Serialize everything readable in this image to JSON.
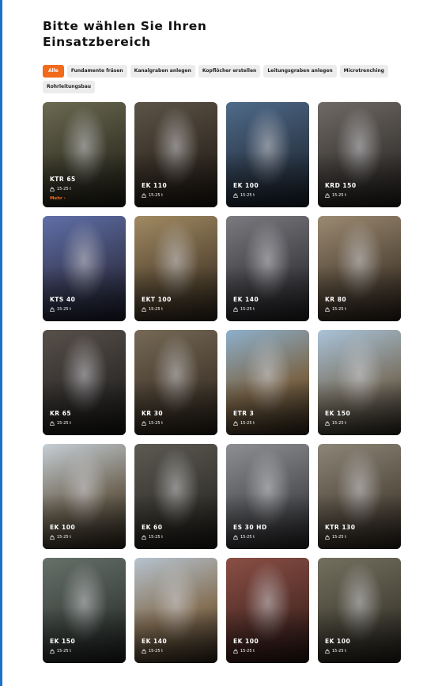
{
  "heading": "Bitte wählen Sie Ihren Einsatzbereich",
  "filters": [
    {
      "label": "Alle",
      "active": true
    },
    {
      "label": "Fundamente fräsen",
      "active": false
    },
    {
      "label": "Kanalgraben anlegen",
      "active": false
    },
    {
      "label": "Kopflöcher erstellen",
      "active": false
    },
    {
      "label": "Leitungsgraben anlegen",
      "active": false
    },
    {
      "label": "Microtrenching",
      "active": false
    },
    {
      "label": "Rohrleitungsbau",
      "active": false
    }
  ],
  "more_label": "Mehr  ›",
  "products": [
    {
      "name": "KTR 65",
      "weight": "15-25 t",
      "more": true,
      "palette": [
        "#6b6a52",
        "#3c3b2c",
        "#1d1c15"
      ]
    },
    {
      "name": "EK 110",
      "weight": "15-25 t",
      "palette": [
        "#5d5448",
        "#372f26",
        "#1b1611"
      ]
    },
    {
      "name": "EK 100",
      "weight": "15-25 t",
      "palette": [
        "#4f6b8a",
        "#2f3d4f",
        "#17202a"
      ]
    },
    {
      "name": "KRD 150",
      "weight": "15-25 t",
      "palette": [
        "#6f6a66",
        "#423e3b",
        "#1f1c1a"
      ]
    },
    {
      "name": "KTS 40",
      "weight": "15-25 t",
      "palette": [
        "#5f6fa8",
        "#3b3f5c",
        "#1a1c2b"
      ]
    },
    {
      "name": "EKT 100",
      "weight": "15-25 t",
      "palette": [
        "#a18a63",
        "#5f4f38",
        "#2a2318"
      ]
    },
    {
      "name": "EK 140",
      "weight": "15-25 t",
      "palette": [
        "#7a7a7f",
        "#45454a",
        "#1e1e21"
      ]
    },
    {
      "name": "KR 80",
      "weight": "15-25 t",
      "palette": [
        "#9b8a72",
        "#5a4d3d",
        "#261f18"
      ]
    },
    {
      "name": "KR 65",
      "weight": "15-25 t",
      "palette": [
        "#58504a",
        "#33302e",
        "#151413"
      ]
    },
    {
      "name": "KR 30",
      "weight": "15-25 t",
      "palette": [
        "#766956",
        "#4a3f32",
        "#221c15"
      ]
    },
    {
      "name": "ETR 3",
      "weight": "15-25 t",
      "palette": [
        "#8db0cc",
        "#7a6548",
        "#2c2218"
      ]
    },
    {
      "name": "EK 150",
      "weight": "15-25 t",
      "palette": [
        "#a9c3d9",
        "#7b7466",
        "#2b271f"
      ]
    },
    {
      "name": "EK 100",
      "weight": "15-25 t",
      "palette": [
        "#c6cfd6",
        "#6e6555",
        "#2a241b"
      ]
    },
    {
      "name": "EK 60",
      "weight": "15-25 t",
      "palette": [
        "#5c5a52",
        "#3a3832",
        "#181714"
      ]
    },
    {
      "name": "ES 30 HD",
      "weight": "15-25 t",
      "palette": [
        "#8e8f92",
        "#55565a",
        "#232325"
      ]
    },
    {
      "name": "KTR 130",
      "weight": "15-25 t",
      "palette": [
        "#8d8578",
        "#5a5145",
        "#252019"
      ]
    },
    {
      "name": "EK 150",
      "weight": "15-25 t",
      "palette": [
        "#66716a",
        "#3f4641",
        "#1b1e1c"
      ]
    },
    {
      "name": "EK 140",
      "weight": "15-25 t",
      "palette": [
        "#b6c3cf",
        "#857055",
        "#2e2419"
      ]
    },
    {
      "name": "EK 100",
      "weight": "15-25 t",
      "palette": [
        "#8a4f45",
        "#56302a",
        "#241412"
      ]
    },
    {
      "name": "EK 100",
      "weight": "15-25 t",
      "palette": [
        "#74705f",
        "#4a473b",
        "#1f1d18"
      ]
    }
  ]
}
